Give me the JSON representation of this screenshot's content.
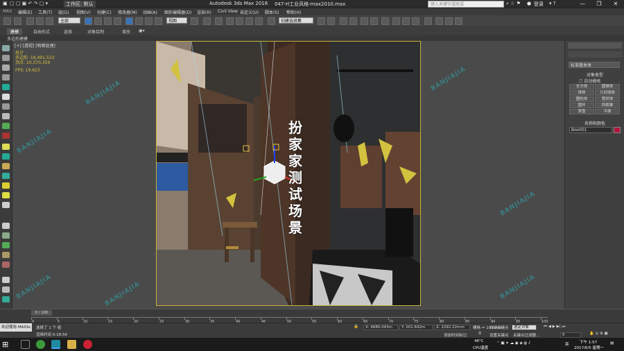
{
  "titlebar": {
    "workspace": "工作区: 默认",
    "app_title": "Autodesk 3ds Max 2016",
    "file_name": "047-H工业风格-max2010.max",
    "search_placeholder": "键入关键字或短语",
    "login": "登录",
    "minimize": "—",
    "restore": "❐",
    "close": "✕"
  },
  "menu": [
    "编辑(E)",
    "工具(T)",
    "组(G)",
    "视图(V)",
    "创建(C)",
    "修改器(M)",
    "动画(A)",
    "图形编辑器(D)",
    "渲染(R)",
    "Civil View",
    "自定义(U)",
    "脚本(S)",
    "帮助(H)"
  ],
  "toolbar": {
    "filter": "全部",
    "coordsys": "视图",
    "selection_set": "创建选择集"
  },
  "ribbon": {
    "tabs": [
      "建模",
      "自由形式",
      "选择",
      "对象绘制",
      "填充"
    ],
    "sub": "多边形建模"
  },
  "viewport": {
    "label": "[+] [透视] [明暗处理]",
    "stats": [
      "总计",
      "多边形: 18,491,533",
      "顶点: 10,370,359",
      "FPS: 19.623"
    ],
    "overlay_text": "扮家家测试场景",
    "watermark": "BANJIAJIA"
  },
  "command_panel": {
    "category": "标准基本体",
    "section_object_type": "对象类型",
    "autogrid": "自动栅格",
    "buttons": [
      "长方体",
      "圆锥体",
      "球体",
      "几何球体",
      "圆柱体",
      "管状体",
      "圆环",
      "四棱锥",
      "茶壶",
      "平面"
    ],
    "section_name_color": "名称和颜色",
    "name_value": "Box001",
    "name_color": "#b2143c"
  },
  "timeline": {
    "frame": "0 / 100",
    "ticks": [
      "0",
      "5",
      "10",
      "15",
      "20",
      "25",
      "30",
      "35",
      "40",
      "45",
      "50",
      "55",
      "60",
      "65",
      "70",
      "75",
      "80",
      "85",
      "90",
      "95",
      "100"
    ]
  },
  "status": {
    "welcome": "欢迎使用 MAXSc",
    "selected": "选择了 1 个 组",
    "render_time": "渲染时间 0:18:56",
    "x": "X: 4680.043m",
    "y": "Y: 201.642m",
    "z": "Z: 2292.22mm",
    "grid": "栅格 = 10.0mm",
    "add_time_tag": "添加时间标记",
    "autokey": "自动关键点",
    "setkey": "设置关键点",
    "sel_object": "选定对象",
    "key_filter": "关键点过滤器...",
    "frame_value": "0"
  },
  "taskbar": {
    "temp": "46°C",
    "cpu": "CPU温度",
    "ime": "英",
    "time": "下午 1:57",
    "date": "2017/6/5 星期一"
  }
}
